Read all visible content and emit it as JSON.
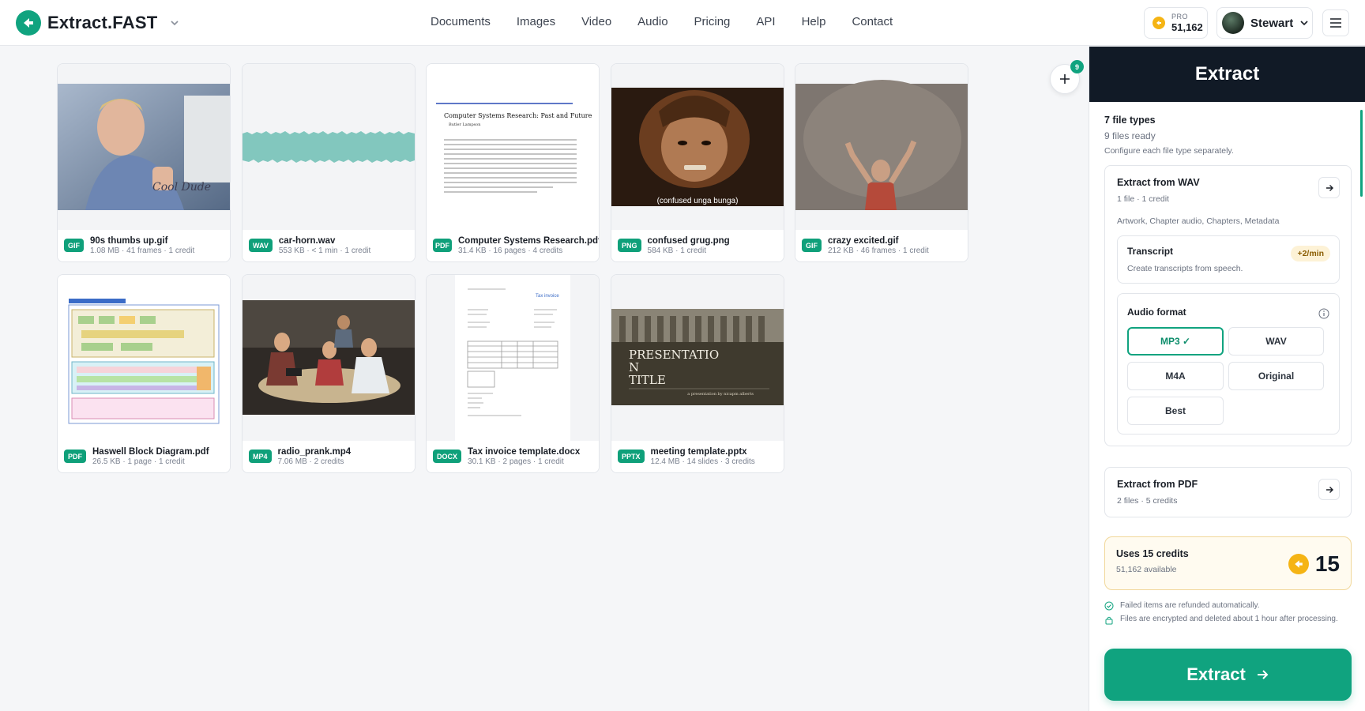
{
  "header": {
    "brand": "Extract.FAST",
    "nav": [
      "Documents",
      "Images",
      "Video",
      "Audio",
      "Pricing",
      "API",
      "Help",
      "Contact"
    ],
    "pro_label": "PRO",
    "pro_credits": "51,162",
    "user_name": "Stewart"
  },
  "files": [
    {
      "name": "90s thumbs up.gif",
      "info": "1.08 MB · 41 frames · 1 credit",
      "type": "GIF"
    },
    {
      "name": "car-horn.wav",
      "info": "553 KB · < 1 min · 1 credit",
      "type": "WAV"
    },
    {
      "name": "Computer Systems Research.pdf",
      "info": "31.4 KB · 16 pages · 4 credits",
      "type": "PDF"
    },
    {
      "name": "confused grug.png",
      "info": "584 KB · 1 credit",
      "type": "PNG"
    },
    {
      "name": "crazy excited.gif",
      "info": "212 KB · 46 frames · 1 credit",
      "type": "GIF"
    },
    {
      "name": "Haswell Block Diagram.pdf",
      "info": "26.5 KB · 1 page · 1 credit",
      "type": "PDF"
    },
    {
      "name": "radio_prank.mp4",
      "info": "7.06 MB · 2 credits",
      "type": "MP4"
    },
    {
      "name": "Tax invoice template.docx",
      "info": "30.1 KB · 2 pages · 1 credit",
      "type": "DOCX"
    },
    {
      "name": "meeting template.pptx",
      "info": "12.4 MB · 14 slides · 3 credits",
      "type": "PPTX"
    }
  ],
  "thumbs": {
    "pdf_title": "Computer Systems Research: Past and Future",
    "pdf_author": "Butler Lampson",
    "grug_caption": "(confused unga bunga)",
    "invoice_heading": "Tax invoice",
    "slide_title": "PRESENTATIO N TITLE",
    "slide_sub": "a presentation by nicapm alberts"
  },
  "add_count": "9",
  "panel": {
    "title": "Extract",
    "summary_types": "7 file types",
    "summary_ready": "9 files ready",
    "summary_hint": "Configure each file type separately.",
    "wav": {
      "title": "Extract from WAV",
      "sub": "1 file · 1 credit",
      "tags": "Artwork, Chapter audio, Chapters, Metadata",
      "transcript_title": "Transcript",
      "transcript_rate": "+2/min",
      "transcript_sub": "Create transcripts from speech.",
      "format_title": "Audio format",
      "formats": [
        "MP3 ✓",
        "WAV",
        "M4A",
        "Original",
        "Best"
      ],
      "selected_format": "MP3"
    },
    "pdf": {
      "title": "Extract from PDF",
      "sub": "2 files · 5 credits"
    },
    "credits_title": "Uses 15 credits",
    "credits_available": "51,162 available",
    "credits_amount": "15",
    "note_refund": "Failed items are refunded automatically.",
    "note_privacy": "Files are encrypted and deleted about 1 hour after processing.",
    "extract_button": "Extract"
  },
  "colors": {
    "accent": "#10a37f",
    "panel_header": "#111a26",
    "coin": "#f5b414"
  }
}
